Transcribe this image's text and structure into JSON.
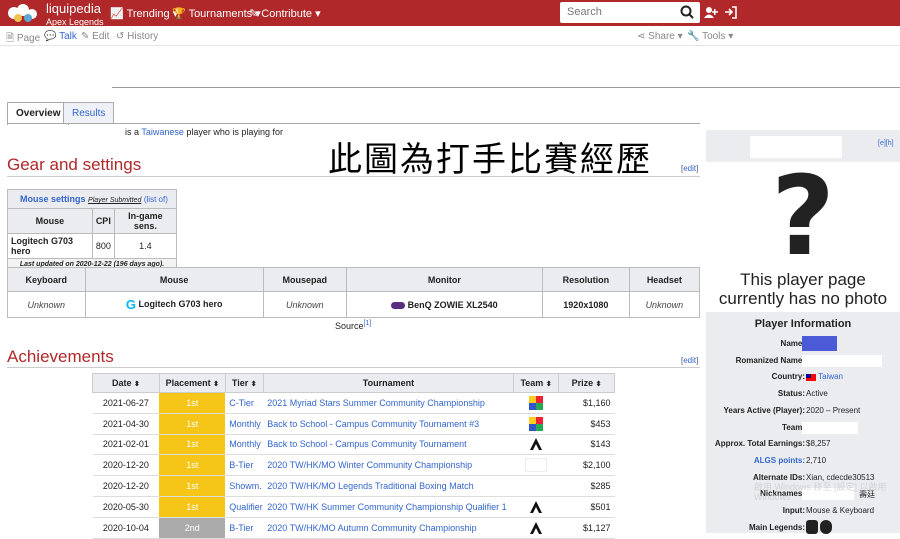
{
  "header": {
    "brand": "liquipedia",
    "brand_sub": "Apex Legends",
    "nav": [
      "Trending",
      "Tournaments",
      "Contribute"
    ],
    "search_placeholder": "Search"
  },
  "subnav": {
    "page": "Page",
    "talk": "Talk",
    "edit": "Edit",
    "history": "History",
    "share": "Share",
    "tools": "Tools"
  },
  "tabs": [
    "Overview",
    "Results"
  ],
  "intro": {
    "before": "is a",
    "nationality": "Taiwanese",
    "after": "player who is playing for"
  },
  "overlay_note": "此圖為打手比賽經歷",
  "gear": {
    "title": "Gear and settings",
    "edit": "[edit]",
    "mouse_settings": {
      "title": "Mouse settings",
      "submitted": "Player Submitted",
      "list": "(list of)",
      "headers": [
        "Mouse",
        "CPI",
        "In-game sens."
      ],
      "row": [
        "Logitech G703 hero",
        "800",
        "1.4"
      ],
      "updated": "Last updated on 2020-12-22 (196 days ago)."
    },
    "hardware": {
      "headers": [
        "Keyboard",
        "Mouse",
        "Mousepad",
        "Monitor",
        "Resolution",
        "Headset"
      ],
      "row": [
        "Unknown",
        "Logitech G703 hero",
        "Unknown",
        "BenQ ZOWIE XL2540",
        "1920x1080",
        "Unknown"
      ]
    },
    "source": "Source",
    "source_ref": "[1]"
  },
  "achievements": {
    "title": "Achievements",
    "edit": "[edit]",
    "headers": [
      "Date",
      "Placement",
      "Tier",
      "Tournament",
      "Team",
      "Prize"
    ],
    "rows": [
      {
        "date": "2021-06-27",
        "place": "1st",
        "tier": "C-Tier",
        "tournament": "2021 Myriad Stars Summer Community Championship",
        "team": "multi",
        "prize": "$1,160"
      },
      {
        "date": "2021-04-30",
        "place": "1st",
        "tier": "Monthly",
        "tournament": "Back to School - Campus Community Tournament #3",
        "team": "multi",
        "prize": "$453"
      },
      {
        "date": "2021-02-01",
        "place": "1st",
        "tier": "Monthly",
        "tournament": "Back to School - Campus Community Tournament",
        "team": "apex",
        "prize": "$143"
      },
      {
        "date": "2020-12-20",
        "place": "1st",
        "tier": "B-Tier",
        "tournament": "2020 TW/HK/MO Winter Community Championship",
        "team": "blank",
        "prize": "$2,100"
      },
      {
        "date": "2020-12-20",
        "place": "1st",
        "tier": "Showm.",
        "tournament": "2020 TW/HK/MO Legends Traditional Boxing Match",
        "team": "none",
        "prize": "$285"
      },
      {
        "date": "2020-05-30",
        "place": "1st",
        "tier": "Qualifier",
        "tournament": "2020 TW/HK Summer Community Championship Qualifier 1",
        "team": "apex",
        "prize": "$501"
      },
      {
        "date": "2020-10-04",
        "place": "2nd",
        "tier": "B-Tier",
        "tournament": "2020 TW/HK/MO Autumn Community Championship",
        "team": "apex",
        "prize": "$1,127"
      }
    ],
    "colors": {
      "gold": "#f5c518",
      "silver": "#aaaaaa"
    }
  },
  "infobox": {
    "edit": "[e][h]",
    "question": "?",
    "nophoto": "This player page currently has no photo",
    "heading": "Player Information",
    "rows": [
      {
        "k": "Name:",
        "v": ""
      },
      {
        "k": "Romanized Name:",
        "v": ""
      },
      {
        "k": "Country:",
        "v": "Taiwan"
      },
      {
        "k": "Status:",
        "v": "Active"
      },
      {
        "k": "Years Active (Player):",
        "v": "2020 – Present"
      },
      {
        "k": "Team:",
        "v": ""
      },
      {
        "k": "Approx. Total Earnings:",
        "v": "$8,257"
      },
      {
        "k": "ALGS points:",
        "v": "2,710"
      },
      {
        "k": "Alternate IDs:",
        "v": "Xian, cdecde30513"
      },
      {
        "k": "Nicknames:",
        "v": "壽廷"
      },
      {
        "k": "Input:",
        "v": "Mouse & Keyboard"
      },
      {
        "k": "Main Legends:",
        "v": ""
      }
    ],
    "watermark": "啟用 Windows 移至 [設定] 以啟用 Windows"
  }
}
